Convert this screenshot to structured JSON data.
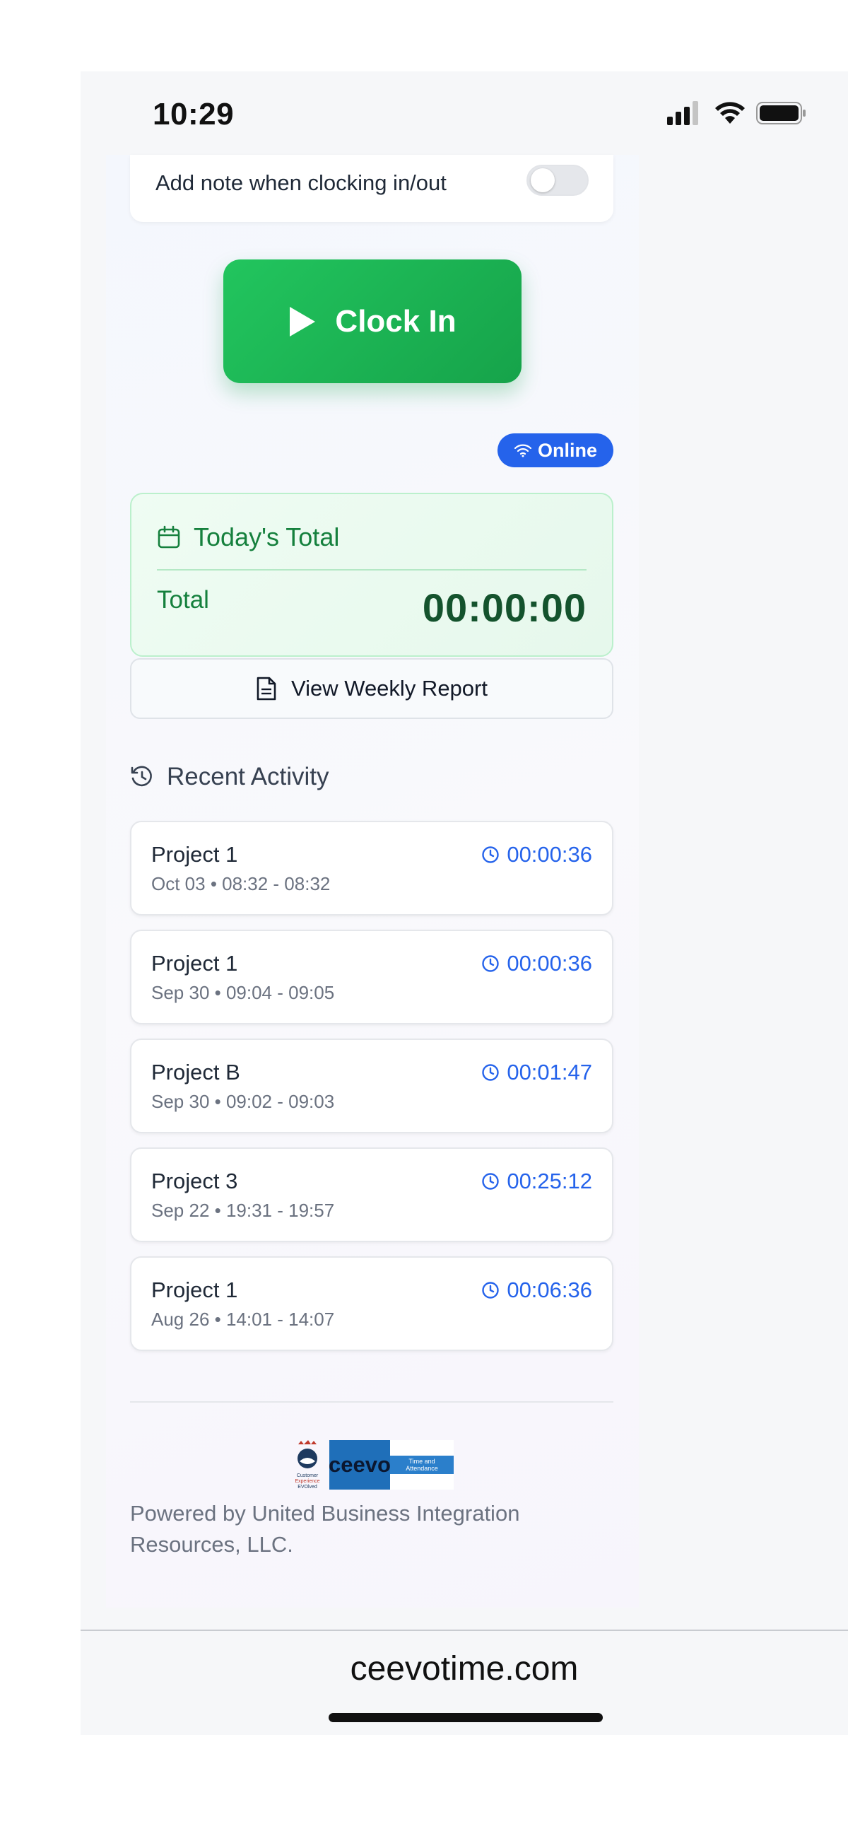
{
  "status": {
    "time": "10:29",
    "icons": [
      "signal-icon",
      "wifi-icon",
      "battery-icon"
    ]
  },
  "settings": {
    "note_label": "Add note when clocking in/out",
    "note_enabled": false
  },
  "clock_button": {
    "label": "Clock In",
    "icon": "play-icon",
    "color": "#22c55e"
  },
  "connection": {
    "label": "Online",
    "icon": "wifi-icon",
    "color": "#2563eb"
  },
  "today": {
    "title": "Today's Total",
    "icon": "calendar-icon",
    "total_label": "Total",
    "total_value": "00:00:00"
  },
  "weekly": {
    "label": "View Weekly Report",
    "icon": "document-icon"
  },
  "recent": {
    "title": "Recent Activity",
    "icon": "history-icon",
    "items": [
      {
        "project": "Project 1",
        "detail": "Oct 03 • 08:32 - 08:32",
        "duration": "00:00:36"
      },
      {
        "project": "Project 1",
        "detail": "Sep 30 • 09:04 - 09:05",
        "duration": "00:00:36"
      },
      {
        "project": "Project B",
        "detail": "Sep 30 • 09:02 - 09:03",
        "duration": "00:01:47"
      },
      {
        "project": "Project 3",
        "detail": "Sep 22 • 19:31 - 19:57",
        "duration": "00:25:12"
      },
      {
        "project": "Project 1",
        "detail": "Aug 26 • 14:01 - 14:07",
        "duration": "00:06:36"
      }
    ]
  },
  "footer": {
    "logo_cx_lines": [
      "Customer",
      "Experience",
      "EVOlved"
    ],
    "logo_brand": "ceevo",
    "logo_tag_lines": [
      "Time and",
      "Attendance"
    ],
    "powered_by": "Powered by United Business Integration Resources, LLC."
  },
  "browser": {
    "url": "ceevotime.com"
  }
}
